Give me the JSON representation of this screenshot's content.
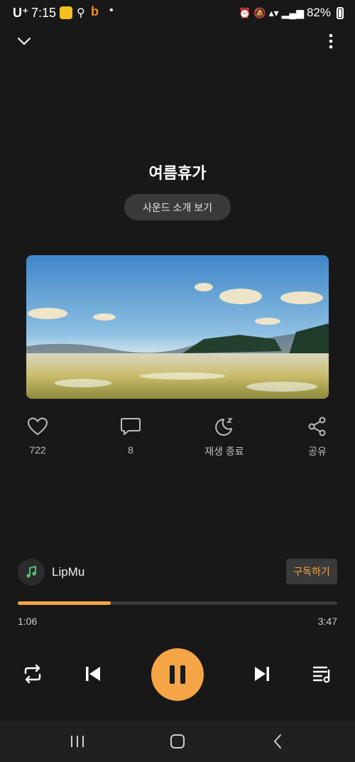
{
  "status_bar": {
    "carrier": "U⁺",
    "time": "7:15",
    "battery": "82%"
  },
  "header": {
    "collapse_icon": "chevron-down-icon",
    "more_icon": "more-vertical-icon"
  },
  "track": {
    "title": "여름휴가",
    "intro_button": "사운드 소개 보기"
  },
  "actions": [
    {
      "icon": "heart-icon",
      "label": "722"
    },
    {
      "icon": "comment-icon",
      "label": "8"
    },
    {
      "icon": "sleep-timer-icon",
      "label": "재생 종료"
    },
    {
      "icon": "share-icon",
      "label": "공유"
    }
  ],
  "channel": {
    "name": "LipMu",
    "subscribe_label": "구독하기"
  },
  "player": {
    "elapsed": "1:06",
    "duration": "3:47",
    "progress": 0.29
  },
  "colors": {
    "accent": "#f5a546",
    "background": "#181818"
  }
}
